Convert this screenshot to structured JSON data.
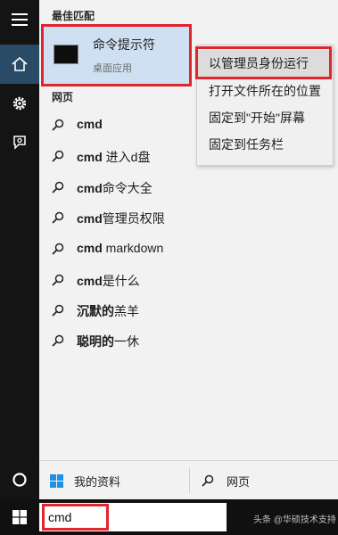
{
  "best_match": {
    "header": "最佳匹配",
    "title": "命令提示符",
    "subtitle": "桌面应用"
  },
  "context_menu": [
    {
      "label": "以管理员身份运行"
    },
    {
      "label": "打开文件所在的位置"
    },
    {
      "label": "固定到\"开始\"屏幕"
    },
    {
      "label": "固定到任务栏"
    }
  ],
  "web": {
    "header": "网页",
    "results": [
      {
        "bold": "cmd",
        "rest": ""
      },
      {
        "bold": "cmd",
        "rest": " 进入d盘"
      },
      {
        "bold": "cmd",
        "rest": "命令大全"
      },
      {
        "bold": "cmd",
        "rest": "管理员权限"
      },
      {
        "bold": "cmd",
        "rest": " markdown"
      },
      {
        "bold": "cmd",
        "rest": "是什么"
      },
      {
        "bold": "沉默的",
        "rest": "羔羊"
      },
      {
        "bold": "聪明的",
        "rest": "一休"
      }
    ]
  },
  "bottom": {
    "my_stuff": "我的资料",
    "web": "网页"
  },
  "taskbar": {
    "search_text": "cmd",
    "watermark": "头条 @华硕技术支持"
  },
  "colors": {
    "highlight": "#cfe0f2",
    "annotation_red": "#e0262d",
    "rail_active": "#2a4b67",
    "windows_blue": "#1e90e6"
  },
  "icons": {
    "rail": [
      "hamburger-icon",
      "home-icon",
      "settings-icon",
      "feedback-icon",
      "cortana-icon"
    ],
    "result": "search-icon",
    "start": "windows-logo-icon"
  }
}
